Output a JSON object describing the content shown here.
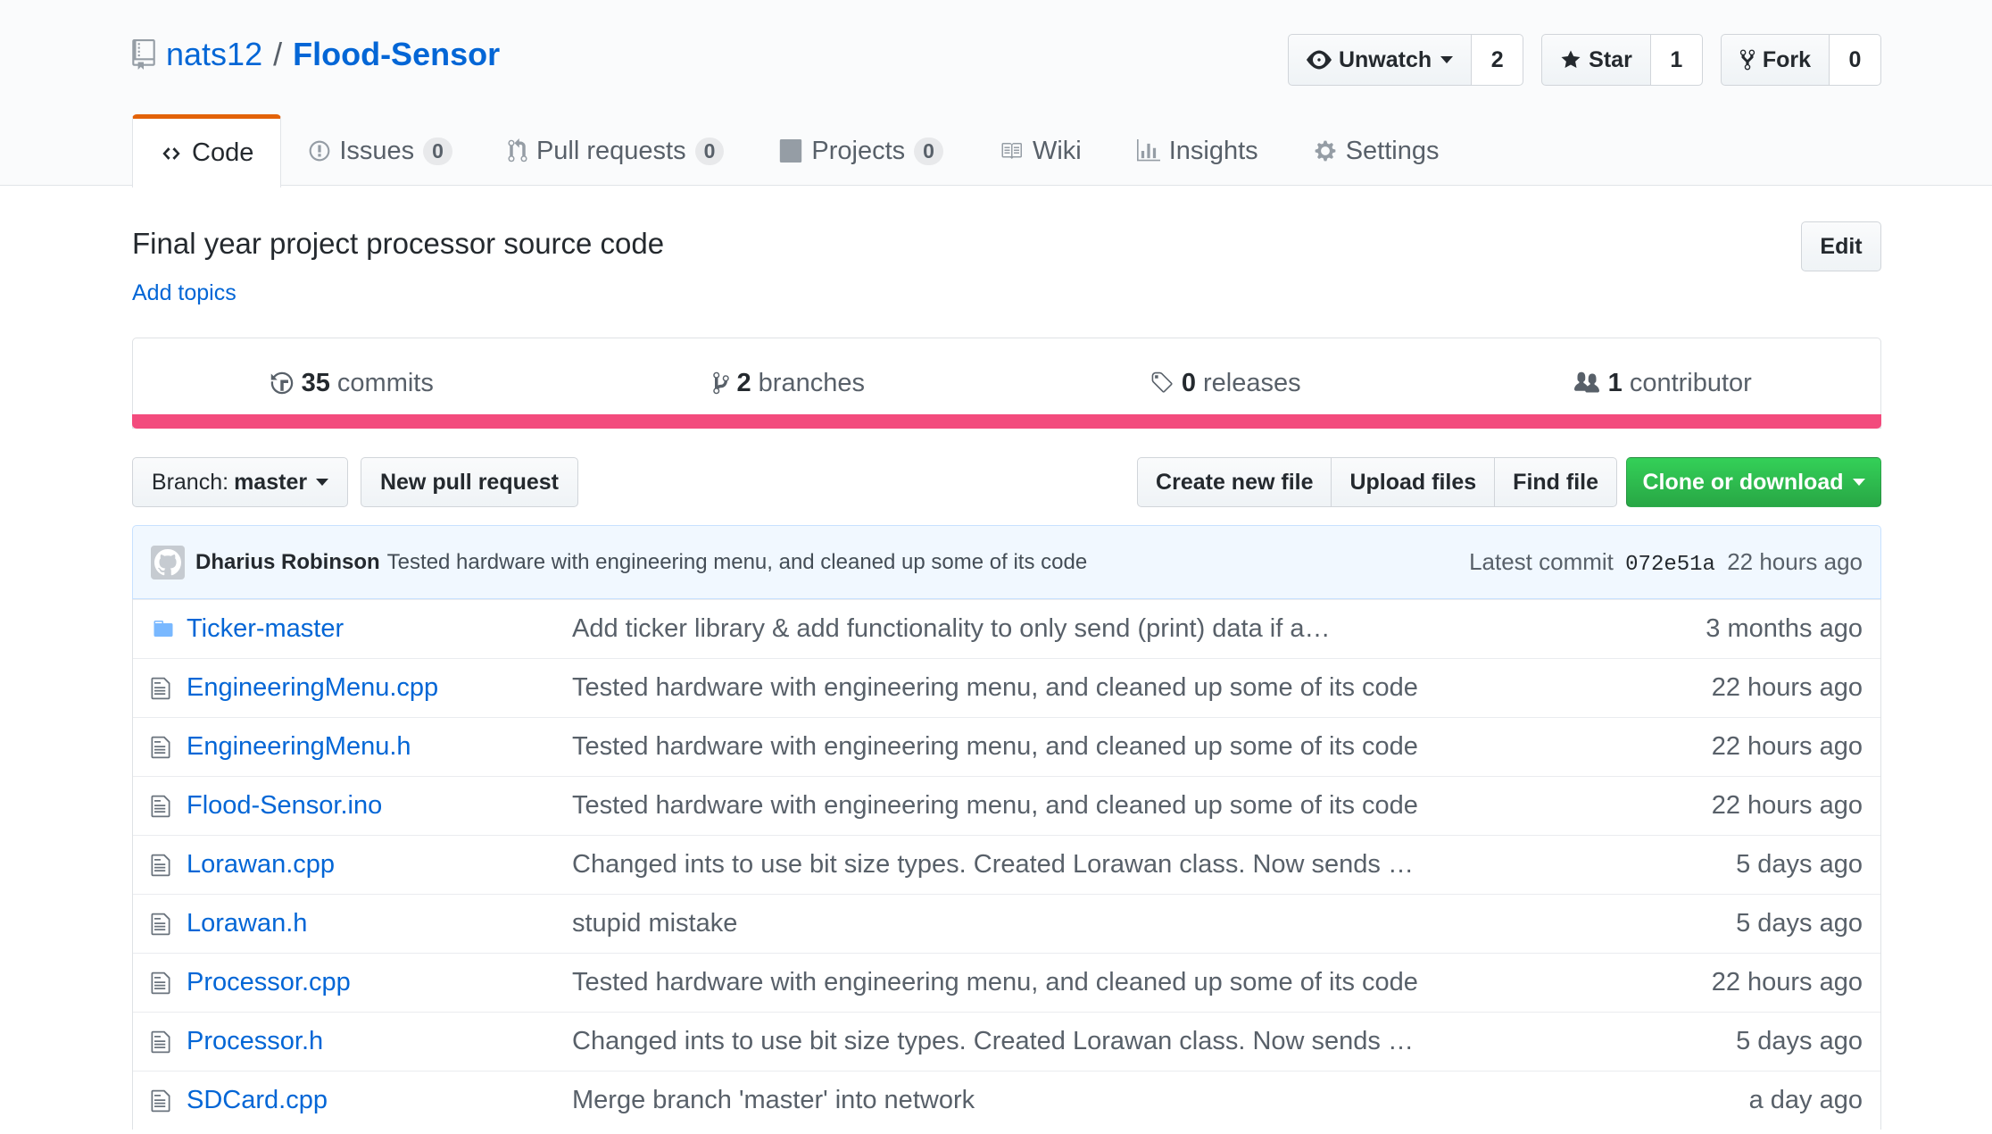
{
  "repo": {
    "owner": "nats12",
    "separator": "/",
    "name": "Flood-Sensor"
  },
  "actions": {
    "watch_label": "Unwatch",
    "watch_count": "2",
    "star_label": "Star",
    "star_count": "1",
    "fork_label": "Fork",
    "fork_count": "0"
  },
  "tabs": [
    {
      "label": "Code",
      "icon": "code-icon"
    },
    {
      "label": "Issues",
      "counter": "0",
      "icon": "issue-icon"
    },
    {
      "label": "Pull requests",
      "counter": "0",
      "icon": "pull-request-icon"
    },
    {
      "label": "Projects",
      "counter": "0",
      "icon": "project-icon"
    },
    {
      "label": "Wiki",
      "icon": "book-icon"
    },
    {
      "label": "Insights",
      "icon": "graph-icon"
    },
    {
      "label": "Settings",
      "icon": "gear-icon"
    }
  ],
  "description": "Final year project processor source code",
  "add_topics": "Add topics",
  "edit_label": "Edit",
  "summary": {
    "commits_count": "35",
    "commits_label": "commits",
    "branches_count": "2",
    "branches_label": "branches",
    "releases_count": "0",
    "releases_label": "releases",
    "contributors_count": "1",
    "contributors_label": "contributor"
  },
  "language_color": "#f34b7d",
  "file_nav": {
    "branch_prefix": "Branch:",
    "branch_name": "master",
    "new_pr": "New pull request",
    "create_file": "Create new file",
    "upload_files": "Upload files",
    "find_file": "Find file",
    "clone": "Clone or download"
  },
  "latest_commit": {
    "author": "Dharius Robinson",
    "message": "Tested hardware with engineering menu, and cleaned up some of its code",
    "prefix": "Latest commit",
    "sha": "072e51a",
    "age": "22 hours ago"
  },
  "files": [
    {
      "type": "dir",
      "name": "Ticker-master",
      "message": "Add ticker library & add functionality to only send (print) data if a…",
      "age": "3 months ago"
    },
    {
      "type": "file",
      "name": "EngineeringMenu.cpp",
      "message": "Tested hardware with engineering menu, and cleaned up some of its code",
      "age": "22 hours ago"
    },
    {
      "type": "file",
      "name": "EngineeringMenu.h",
      "message": "Tested hardware with engineering menu, and cleaned up some of its code",
      "age": "22 hours ago"
    },
    {
      "type": "file",
      "name": "Flood-Sensor.ino",
      "message": "Tested hardware with engineering menu, and cleaned up some of its code",
      "age": "22 hours ago"
    },
    {
      "type": "file",
      "name": "Lorawan.cpp",
      "message": "Changed ints to use bit size types. Created Lorawan class. Now sends …",
      "age": "5 days ago"
    },
    {
      "type": "file",
      "name": "Lorawan.h",
      "message": "stupid mistake",
      "age": "5 days ago"
    },
    {
      "type": "file",
      "name": "Processor.cpp",
      "message": "Tested hardware with engineering menu, and cleaned up some of its code",
      "age": "22 hours ago"
    },
    {
      "type": "file",
      "name": "Processor.h",
      "message": "Changed ints to use bit size types. Created Lorawan class. Now sends …",
      "age": "5 days ago"
    },
    {
      "type": "file",
      "name": "SDCard.cpp",
      "message": "Merge branch 'master' into network",
      "age": "a day ago"
    }
  ]
}
